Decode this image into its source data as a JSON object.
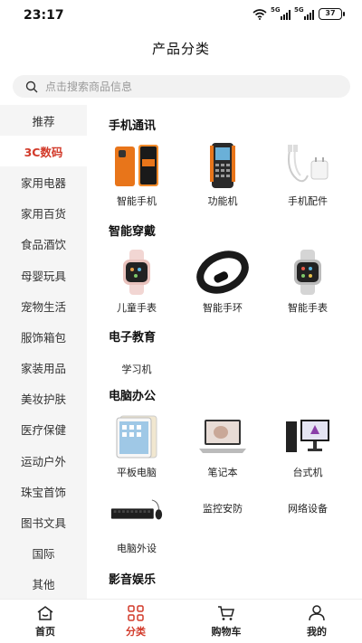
{
  "status": {
    "time": "23:17",
    "battery": "37",
    "signal1": "5G",
    "signal2": "5G"
  },
  "header": {
    "title": "产品分类"
  },
  "search": {
    "placeholder": "点击搜索商品信息"
  },
  "sidebar": {
    "items": [
      {
        "label": "推荐"
      },
      {
        "label": "3C数码",
        "active": true
      },
      {
        "label": "家用电器"
      },
      {
        "label": "家用百货"
      },
      {
        "label": "食品酒饮"
      },
      {
        "label": "母婴玩具"
      },
      {
        "label": "宠物生活"
      },
      {
        "label": "服饰箱包"
      },
      {
        "label": "家装用品"
      },
      {
        "label": "美妆护肤"
      },
      {
        "label": "医疗保健"
      },
      {
        "label": "运动户外"
      },
      {
        "label": "珠宝首饰"
      },
      {
        "label": "图书文具"
      },
      {
        "label": "国际"
      },
      {
        "label": "其他"
      }
    ]
  },
  "sections": [
    {
      "title": "手机通讯",
      "products": [
        {
          "name": "智能手机",
          "icon": "orange-phone"
        },
        {
          "name": "功能机",
          "icon": "rugged-phone"
        },
        {
          "name": "手机配件",
          "icon": "charger"
        }
      ]
    },
    {
      "title": "智能穿戴",
      "products": [
        {
          "name": "儿童手表",
          "icon": "pink-watch"
        },
        {
          "name": "智能手环",
          "icon": "fitness-band"
        },
        {
          "name": "智能手表",
          "icon": "smart-watch"
        }
      ]
    },
    {
      "title": "电子教育",
      "products": [
        {
          "name": "学习机",
          "icon": ""
        }
      ]
    },
    {
      "title": "电脑办公",
      "products": [
        {
          "name": "平板电脑",
          "icon": "tablet"
        },
        {
          "name": "笔记本",
          "icon": "laptop"
        },
        {
          "name": "台式机",
          "icon": "desktop"
        },
        {
          "name": "电脑外设",
          "icon": "keyboard"
        },
        {
          "name": "监控安防",
          "icon": ""
        },
        {
          "name": "网络设备",
          "icon": ""
        }
      ]
    },
    {
      "title": "影音娱乐",
      "products": []
    }
  ],
  "bottom_nav": [
    {
      "label": "首页",
      "icon": "home-icon"
    },
    {
      "label": "分类",
      "icon": "category-icon",
      "active": true
    },
    {
      "label": "购物车",
      "icon": "cart-icon"
    },
    {
      "label": "我的",
      "icon": "user-icon"
    }
  ],
  "colors": {
    "accent": "#d23a2a",
    "sidebar_bg": "#f5f5f5"
  }
}
